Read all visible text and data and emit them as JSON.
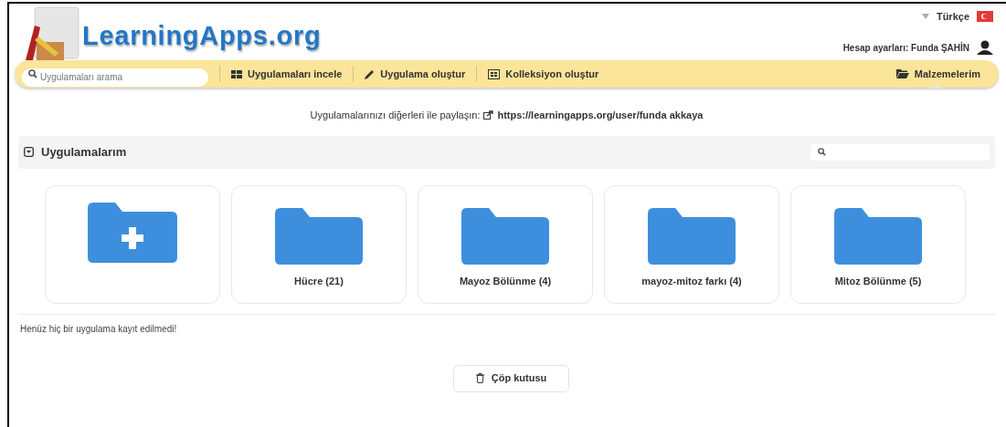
{
  "header": {
    "logo": "LearningApps.org",
    "language": "Türkçe",
    "account": "Hesap ayarları: Funda ŞAHİN"
  },
  "nav": {
    "search_placeholder": "Uygulamaları arama",
    "items": [
      {
        "label": "Uygulamaları incele",
        "selected": false
      },
      {
        "label": "Uygulama oluştur",
        "selected": false
      },
      {
        "label": "Kolleksiyon oluştur",
        "selected": false
      },
      {
        "label": "Malzemelerim",
        "selected": true
      }
    ]
  },
  "share": {
    "text": "Uygulamalarınızı diğerleri ile paylaşın:",
    "link": "https://learningapps.org/user/funda akkaya"
  },
  "panel": {
    "title": "Uygulamalarım"
  },
  "folders": [
    {
      "kind": "new"
    },
    {
      "kind": "folder",
      "label": "Hücre (21)"
    },
    {
      "kind": "folder",
      "label": "Mayoz Bölünme (4)"
    },
    {
      "kind": "folder",
      "label": "mayoz-mitoz farkı (4)"
    },
    {
      "kind": "folder",
      "label": "Mitoz Bölünme (5)"
    }
  ],
  "empty_message": "Henüz hiç bir uygulama kayıt edilmedi!",
  "trash_button": "Çöp kutusu"
}
